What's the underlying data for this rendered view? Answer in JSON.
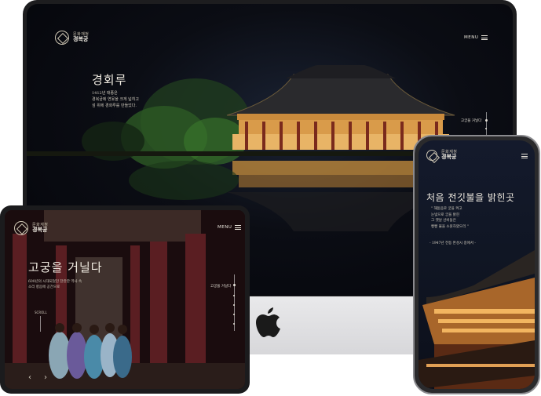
{
  "imac": {
    "logo_sub": "문화재청",
    "logo_main": "경복궁",
    "menu_label": "MENU",
    "hero_title": "경회루",
    "hero_desc": [
      "1412년 태종은",
      "경복궁에 연못을 크게 넓히고",
      "섬 위에 경회루를 만들었다."
    ],
    "side_nav_label": "고궁을 거닐다"
  },
  "ipad": {
    "logo_sub": "문화재청",
    "logo_main": "경복궁",
    "menu_label": "MENU",
    "hero_title": "고궁을 거닐다",
    "hero_desc": [
      "600년의 시대되었던 찬란한 역사 속",
      "소리 향음에 공간으로"
    ],
    "scroll_label": "SCROLL",
    "side_nav_label": "고궁을 거닐다"
  },
  "iphone": {
    "logo_sub": "문화재청",
    "logo_main": "경복궁",
    "hero_title": "처음 전깃불을 밝힌곳",
    "quote": [
      "\" 해돋음로 궁을 켜고",
      "눈빛으로 궁을 밝힌",
      "그 옛날 선비들은",
      "빵빵 불을 소원하였으리 \""
    ],
    "caption": "- 1947년 전등 완성시 중에서 -"
  },
  "colors": {
    "night_sky": "#0b0d14",
    "gold_light": "#f2b560",
    "palace_red": "#3b1c20",
    "text_cream": "#f1ece2"
  }
}
